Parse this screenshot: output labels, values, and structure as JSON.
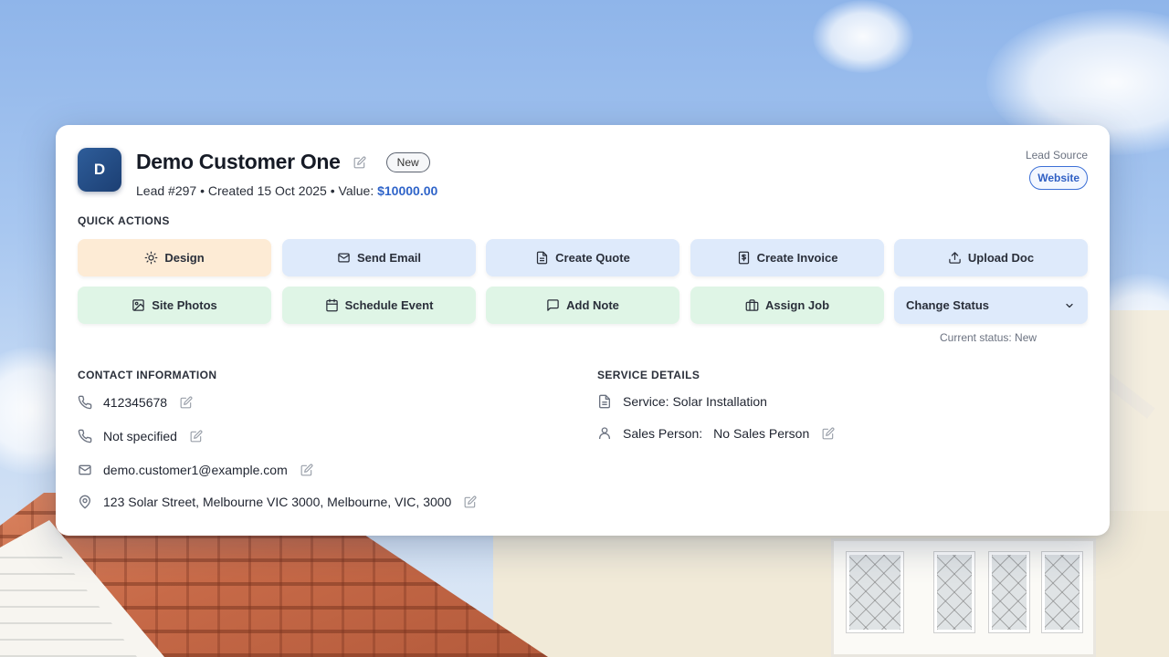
{
  "customer": {
    "avatar_initial": "D",
    "name": "Demo Customer One",
    "status_badge": "New",
    "lead_number": "Lead #297",
    "created": "Created 15 Oct 2025",
    "value_label": "Value:",
    "value": "$10000.00",
    "separator": "•"
  },
  "lead_source": {
    "label": "Lead Source",
    "value": "Website"
  },
  "quick_actions": {
    "heading": "QUICK ACTIONS",
    "buttons": [
      {
        "label": "Design",
        "icon": "sun-icon",
        "color": "#fdebd5"
      },
      {
        "label": "Send Email",
        "icon": "mail-icon",
        "color": "#deeafb"
      },
      {
        "label": "Create Quote",
        "icon": "document-icon",
        "color": "#deeafb"
      },
      {
        "label": "Create Invoice",
        "icon": "invoice-icon",
        "color": "#deeafb"
      },
      {
        "label": "Upload Doc",
        "icon": "upload-icon",
        "color": "#deeafb"
      },
      {
        "label": "Site Photos",
        "icon": "image-icon",
        "color": "#dff5e6"
      },
      {
        "label": "Schedule Event",
        "icon": "calendar-icon",
        "color": "#dff5e6"
      },
      {
        "label": "Add Note",
        "icon": "chat-icon",
        "color": "#dff5e6"
      },
      {
        "label": "Assign Job",
        "icon": "briefcase-icon",
        "color": "#dff5e6"
      }
    ],
    "change_status": "Change Status",
    "current_status": "Current status: New"
  },
  "contact": {
    "heading": "CONTACT INFORMATION",
    "phone": "412345678",
    "phone_alt": "Not specified",
    "email": "demo.customer1@example.com",
    "address": "123 Solar Street, Melbourne VIC 3000, Melbourne, VIC, 3000"
  },
  "service": {
    "heading": "SERVICE DETAILS",
    "service": "Service: Solar Installation",
    "sales_person_label": "Sales Person:",
    "sales_person": "No Sales Person"
  },
  "colors": {
    "accent_blue": "#2f64c9",
    "avatar_bg": "#1c3f73",
    "orange_action": "#fdebd5",
    "blue_action": "#deeafb",
    "green_action": "#dff5e6"
  }
}
